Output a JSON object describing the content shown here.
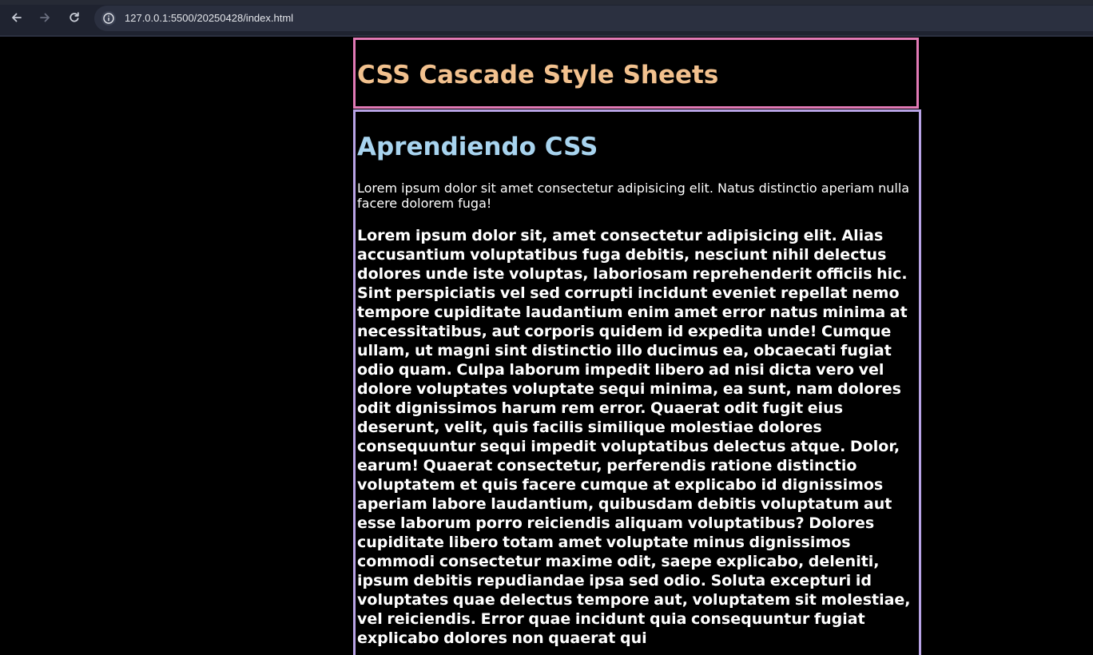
{
  "browser": {
    "url": "127.0.0.1:5500/20250428/index.html",
    "colors": {
      "toolbar": "#1f2330",
      "address": "#2b3040",
      "icon": "#c8ccd6",
      "icon_disabled": "#6b7080"
    }
  },
  "page": {
    "header_title": "CSS Cascade Style Sheets",
    "main_heading": "Aprendiendo CSS",
    "intro": "Lorem ipsum dolor sit amet consectetur adipisicing elit. Natus distinctio aperiam nulla facere dolorem fuga!",
    "body_bold": "Lorem ipsum dolor sit, amet consectetur adipisicing elit. Alias accusantium voluptatibus fuga debitis, nesciunt nihil delectus dolores unde iste voluptas, laboriosam reprehenderit officiis hic. Sint perspiciatis vel sed corrupti incidunt eveniet repellat nemo tempore cupiditate laudantium enim amet error natus minima at necessitatibus, aut corporis quidem id expedita unde! Cumque ullam, ut magni sint distinctio illo ducimus ea, obcaecati fugiat odio quam. Culpa laborum impedit libero ad nisi dicta vero vel dolore voluptates voluptate sequi minima, ea sunt, nam dolores odit dignissimos harum rem error. Quaerat odit fugit eius deserunt, velit, quis facilis similique molestiae dolores consequuntur sequi impedit voluptatibus delectus atque. Dolor, earum! Quaerat consectetur, perferendis ratione distinctio voluptatem et quis facere cumque at explicabo id dignissimos aperiam labore laudantium, quibusdam debitis voluptatum aut esse laborum porro reiciendis aliquam voluptatibus? Dolores cupiditate libero totam amet voluptate minus dignissimos commodi consectetur maxime odit, saepe explicabo, deleniti, ipsum debitis repudiandae ipsa sed odio. Soluta excepturi id voluptates quae delectus tempore aut, voluptatem sit molestiae, vel reiciendis. Error quae incidunt quia consequuntur fugiat explicabo dolores non quaerat qui",
    "colors": {
      "background": "#000000",
      "header_border": "#e27ab6",
      "header_title": "#f2c18e",
      "main_border": "#b9a4e6",
      "main_heading": "#a8d4ef",
      "text": "#ffffff"
    }
  },
  "icons": {
    "back": "arrow-left-icon",
    "forward": "arrow-right-icon",
    "reload": "reload-icon",
    "site_info": "info-icon"
  }
}
